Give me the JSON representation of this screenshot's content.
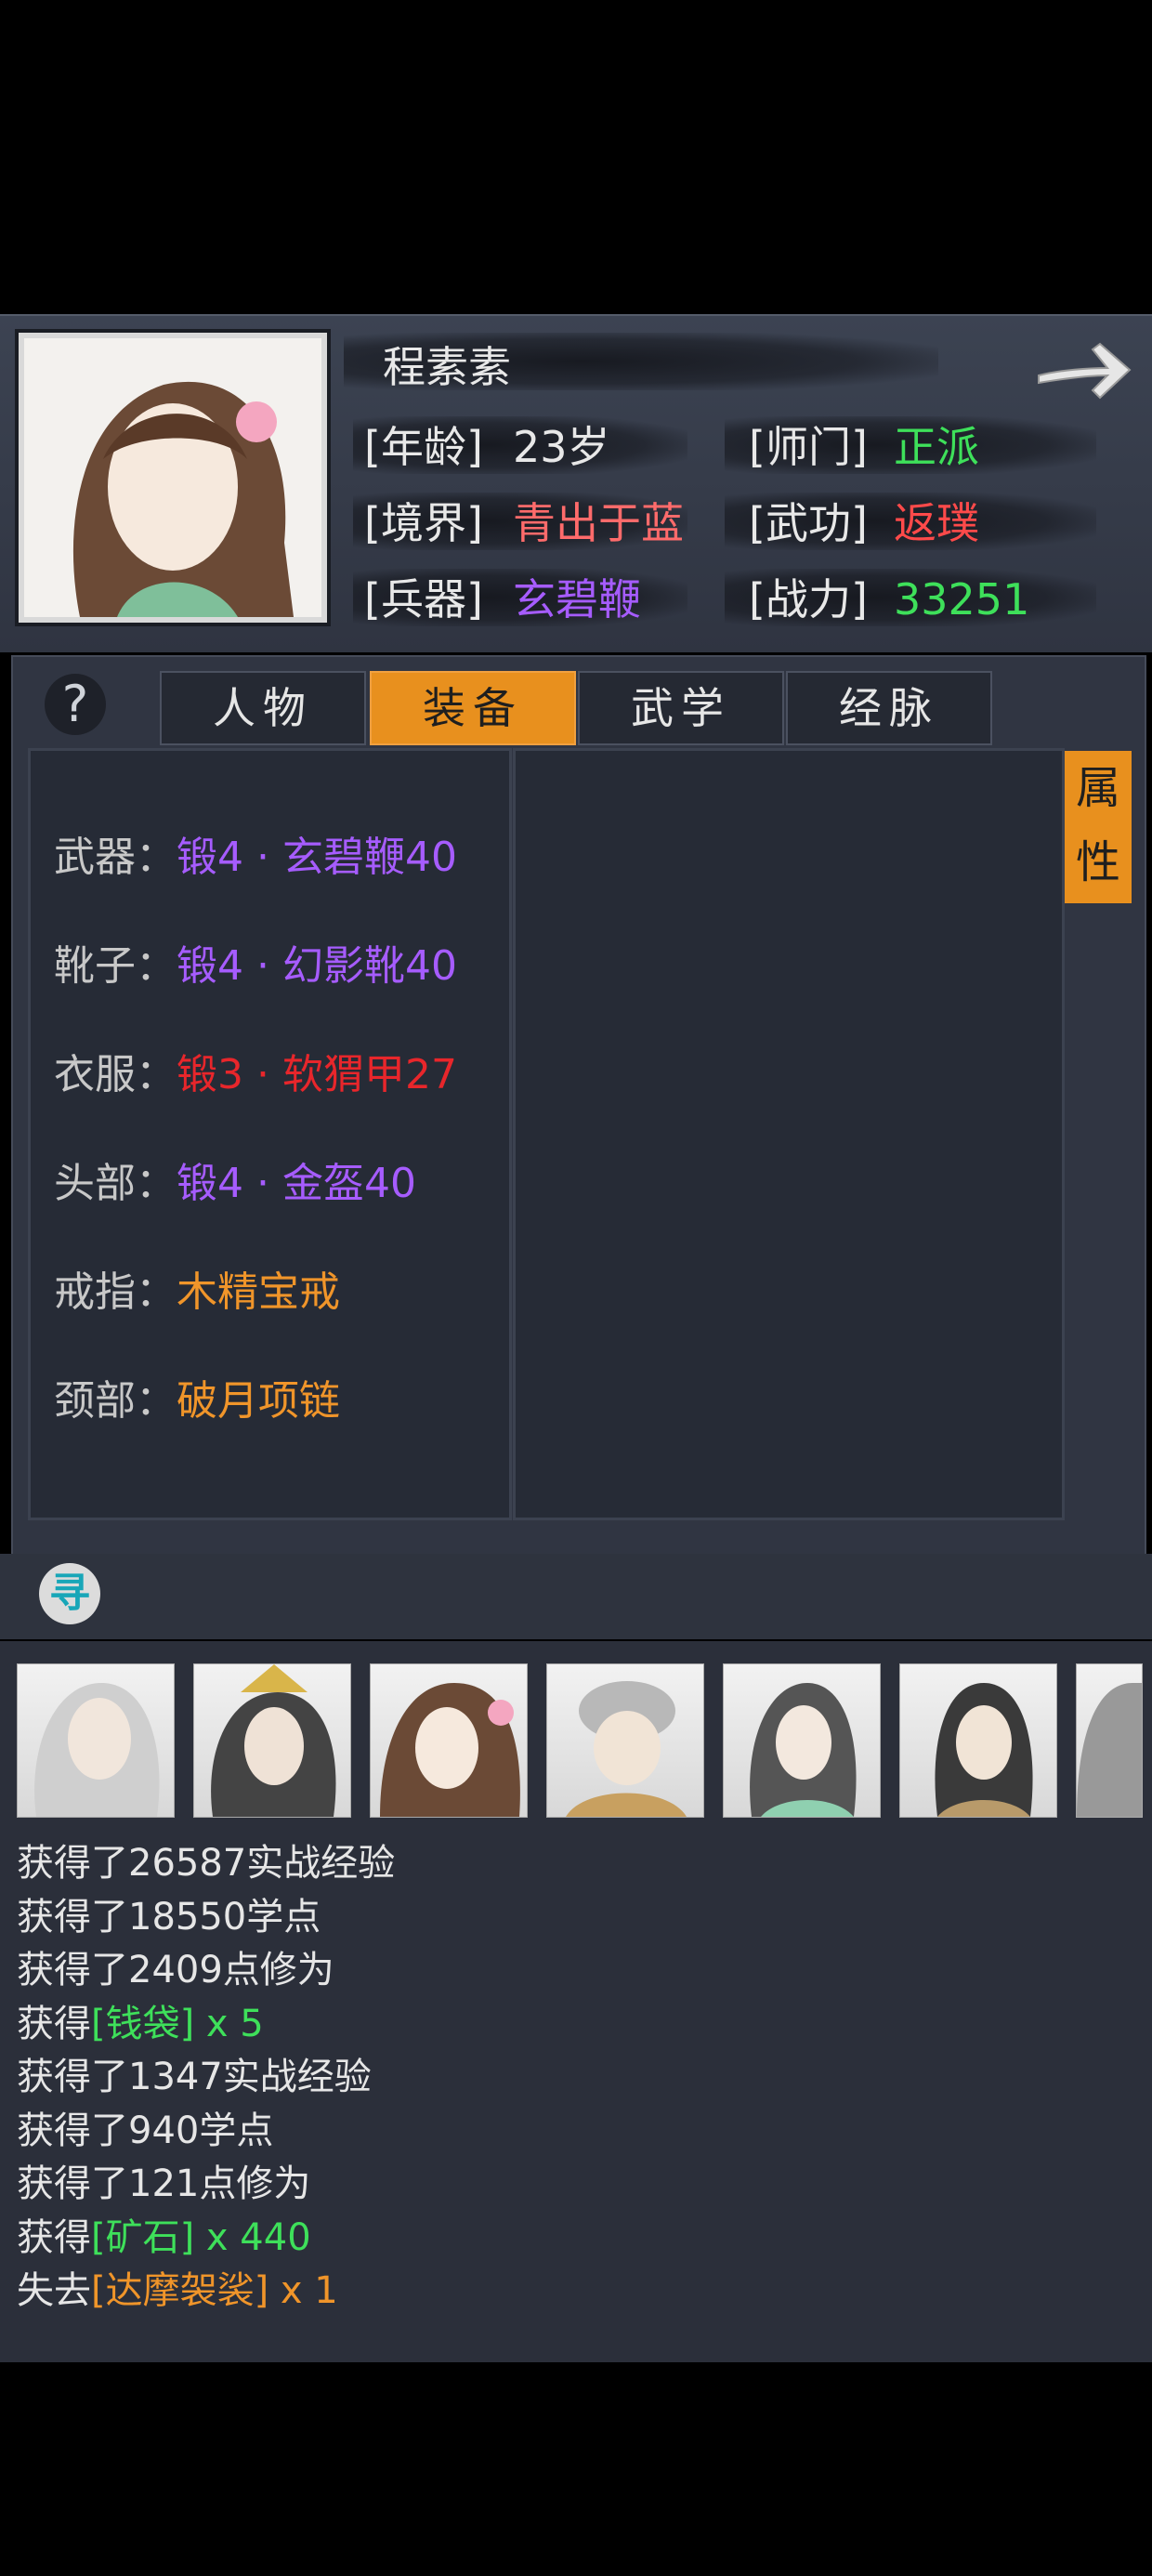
{
  "header": {
    "name": "程素素",
    "rows": [
      {
        "label_l": "[年龄]",
        "value_l": "23岁",
        "color_l": "#e8e8e8",
        "label_r": "[师门]",
        "value_r": "正派",
        "color_r": "#3ee05a"
      },
      {
        "label_l": "[境界]",
        "value_l": "青出于蓝",
        "color_l": "#ff6b6b",
        "label_r": "[武功]",
        "value_r": "返璞",
        "color_r": "#ff4a4a"
      },
      {
        "label_l": "[兵器]",
        "value_l": "玄碧鞭",
        "color_l": "#a65cff",
        "label_r": "[战力]",
        "value_r": "33251",
        "color_r": "#3ee05a"
      }
    ]
  },
  "tabs": {
    "help": "?",
    "t1": "人物",
    "t2": "装备",
    "t3": "武学",
    "t4": "经脉",
    "attr1": "属",
    "attr2": "性"
  },
  "equipment": [
    {
      "label": "武器：",
      "value": "锻4 · 玄碧鞭40",
      "color": "#a65cff"
    },
    {
      "label": "靴子：",
      "value": "锻4 · 幻影靴40",
      "color": "#a65cff"
    },
    {
      "label": "衣服：",
      "value": "锻3 · 软猬甲27",
      "color": "#e8262b"
    },
    {
      "label": "头部：",
      "value": "锻4 · 金盔40",
      "color": "#a65cff"
    },
    {
      "label": "戒指：",
      "value": "木精宝戒",
      "color": "#f0952a"
    },
    {
      "label": "颈部：",
      "value": "破月项链",
      "color": "#f0952a"
    }
  ],
  "seek_icon_glyph": "寻",
  "log": [
    {
      "pre": "获得了26587实战经验",
      "item": "",
      "post": "",
      "color": ""
    },
    {
      "pre": "获得了18550学点",
      "item": "",
      "post": "",
      "color": ""
    },
    {
      "pre": "获得了2409点修为",
      "item": "",
      "post": "",
      "color": ""
    },
    {
      "pre": "获得",
      "item": "[钱袋] x 5",
      "post": "",
      "color": "#3ee05a"
    },
    {
      "pre": "获得了1347实战经验",
      "item": "",
      "post": "",
      "color": ""
    },
    {
      "pre": "获得了940学点",
      "item": "",
      "post": "",
      "color": ""
    },
    {
      "pre": "获得了121点修为",
      "item": "",
      "post": "",
      "color": ""
    },
    {
      "pre": "获得",
      "item": "[矿石] x 440",
      "post": "",
      "color": "#3ee05a"
    },
    {
      "pre": "失去",
      "item": "[达摩袈裟] x 1",
      "post": "",
      "color": "#f0952a"
    }
  ],
  "colors": {
    "accent": "#e8901e",
    "panel": "#303542"
  }
}
